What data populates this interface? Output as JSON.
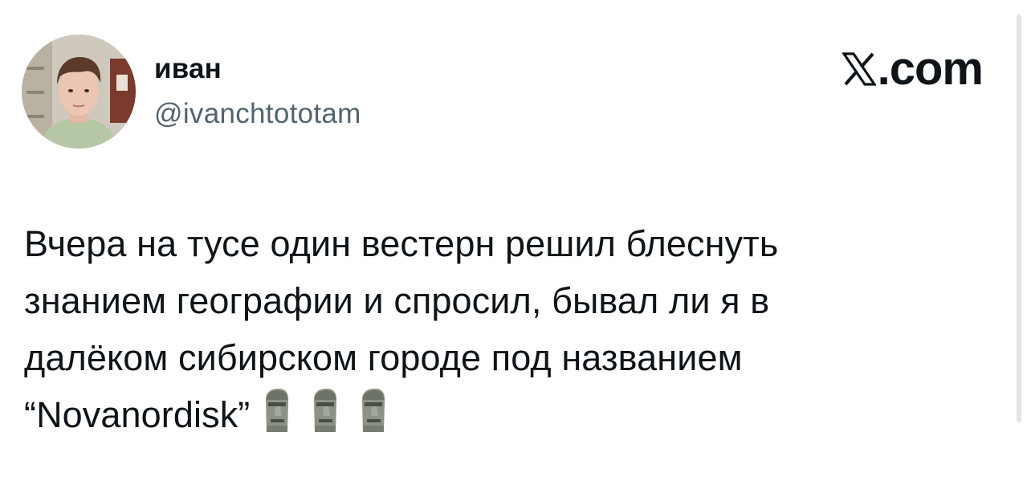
{
  "author": {
    "display_name": "иван",
    "handle": "@ivanchtototam"
  },
  "brand": {
    "domain": ".com",
    "logo_icon": "x-logo-icon"
  },
  "tweet": {
    "lines": [
      "Вчера на тусе один вестерн решил блеснуть",
      "знанием географии и спросил, бывал ли я в",
      "далёком сибирском городе под названием",
      "“Novanordisk”"
    ],
    "emojis": [
      "moai-icon",
      "moai-icon",
      "moai-icon"
    ]
  }
}
